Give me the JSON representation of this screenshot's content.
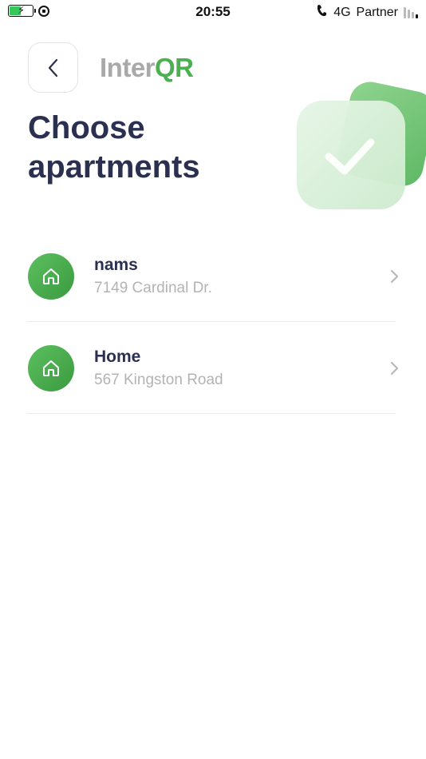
{
  "status_bar": {
    "time": "20:55",
    "network": "4G",
    "carrier": "Partner",
    "icons": [
      "battery-charging-icon",
      "rotation-lock-icon",
      "call-forwarding-icon",
      "signal-icon"
    ]
  },
  "header": {
    "back_icon": "chevron-left-icon",
    "logo_part1": "Inter",
    "logo_part2": "QR"
  },
  "page": {
    "title_line1": "Choose",
    "title_line2": "apartments",
    "hero_icon": "checkmark-cards-illustration"
  },
  "apartments": [
    {
      "name": "nams",
      "address": "7149 Cardinal Dr.",
      "icon": "home-icon"
    },
    {
      "name": "Home",
      "address": "567 Kingston Road",
      "icon": "home-icon"
    }
  ],
  "colors": {
    "accent": "#4caf50",
    "title": "#2b3050",
    "muted": "#b3b3b3"
  }
}
